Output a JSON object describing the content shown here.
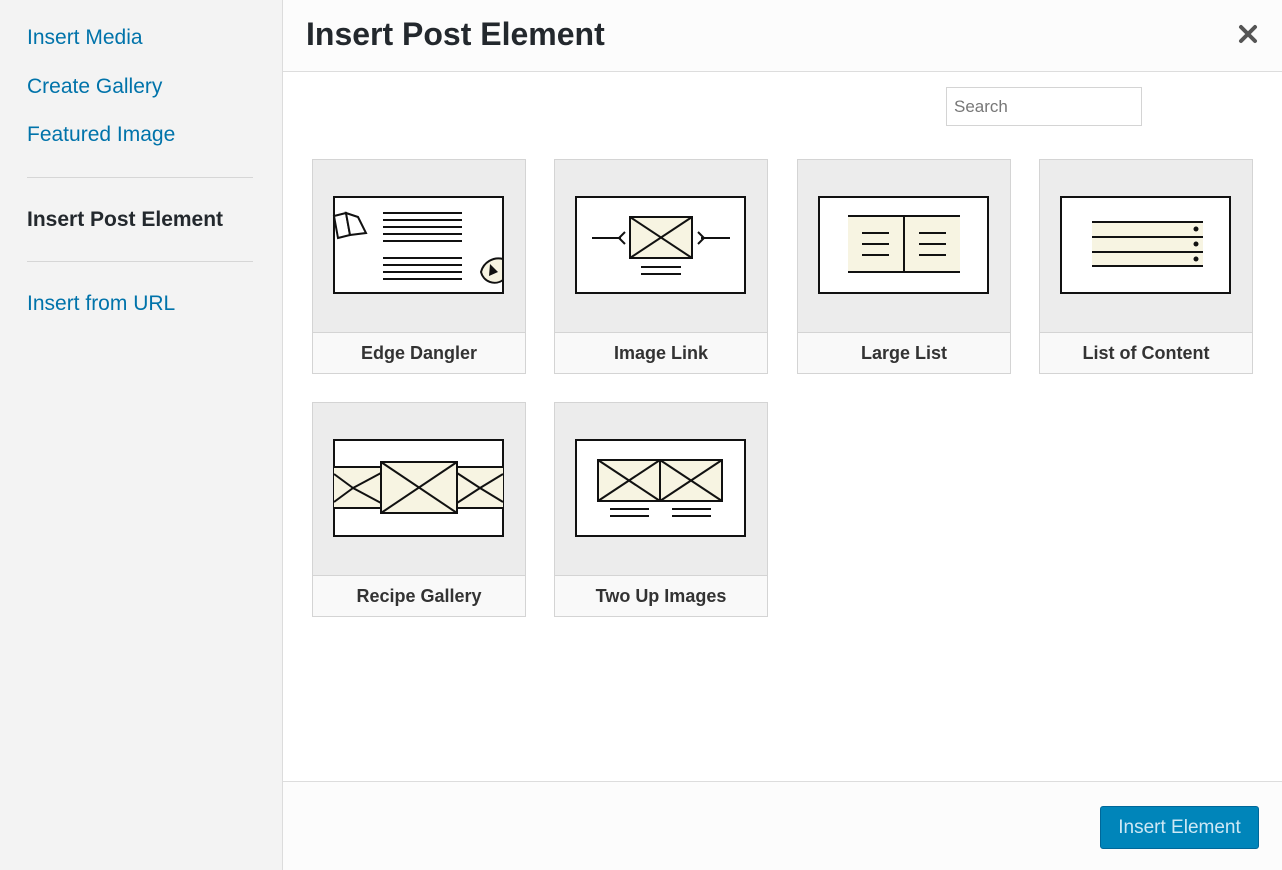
{
  "sidebar": {
    "links": [
      "Insert Media",
      "Create Gallery",
      "Featured Image"
    ],
    "active": "Insert Post Element",
    "bottom_link": "Insert from URL"
  },
  "header": {
    "title": "Insert Post Element",
    "close_icon": "close-icon"
  },
  "search": {
    "placeholder": "Search",
    "value": ""
  },
  "elements": [
    {
      "label": "Edge Dangler",
      "icon": "edge-dangler-icon"
    },
    {
      "label": "Image Link",
      "icon": "image-link-icon"
    },
    {
      "label": "Large List",
      "icon": "large-list-icon"
    },
    {
      "label": "List of Content",
      "icon": "list-of-content-icon"
    },
    {
      "label": "Recipe Gallery",
      "icon": "recipe-gallery-icon"
    },
    {
      "label": "Two Up Images",
      "icon": "two-up-images-icon"
    }
  ],
  "footer": {
    "insert_label": "Insert Element",
    "insert_disabled": true
  },
  "colors": {
    "accent": "#0085ba",
    "link": "#0073aa",
    "placeholder_fill": "#f7f4e2"
  }
}
